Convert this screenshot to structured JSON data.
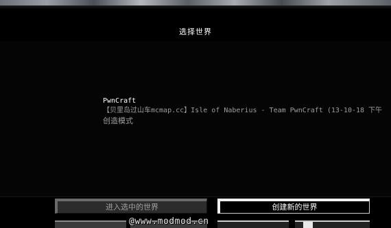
{
  "screen": {
    "title": "选择世界"
  },
  "worlds": [
    {
      "name": "PwnCraft",
      "description": "【贝里岛过山车mcmap.cc】Isle of Naberius - Team PwnCraft (13-10-18 下午",
      "mode": "创造模式"
    }
  ],
  "buttons": {
    "play_selected": "进入选中的世界",
    "create_new": "创建新的世界"
  },
  "watermark": "@www.modmod.cn"
}
